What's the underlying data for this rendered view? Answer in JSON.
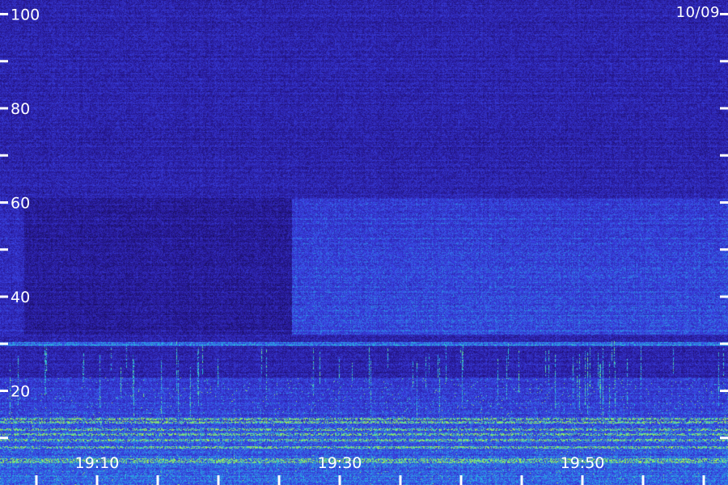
{
  "date_label": "10/09",
  "chart_data": {
    "type": "heatmap",
    "title": "",
    "xlabel": "",
    "ylabel": "",
    "x_range": [
      "19:02",
      "20:02"
    ],
    "x_tick_labels": [
      {
        "value": "19:10",
        "label": "19:10"
      },
      {
        "value": "19:30",
        "label": "19:30"
      },
      {
        "value": "19:50",
        "label": "19:50"
      }
    ],
    "x_minor_tick_interval_minutes": 5,
    "y_range": [
      0,
      103
    ],
    "y_tick_labels": [
      {
        "value": 20,
        "label": "20"
      },
      {
        "value": 40,
        "label": "40"
      },
      {
        "value": 60,
        "label": "60"
      },
      {
        "value": 80,
        "label": "80"
      },
      {
        "value": 100,
        "label": "100"
      }
    ],
    "y_minor_tick_interval": 10,
    "colormap": [
      "#140a4a",
      "#2a1ca0",
      "#3a44e6",
      "#23c8e0",
      "#c8f028"
    ],
    "features": [
      {
        "name": "broadband band",
        "time_start": "19:26",
        "time_end": "20:02",
        "y_from": 32,
        "y_to": 61
      },
      {
        "name": "persistent line",
        "y": 30
      },
      {
        "name": "low-frequency noise",
        "y_from": 2,
        "y_to": 23
      }
    ],
    "grid": false,
    "legend": "none"
  }
}
